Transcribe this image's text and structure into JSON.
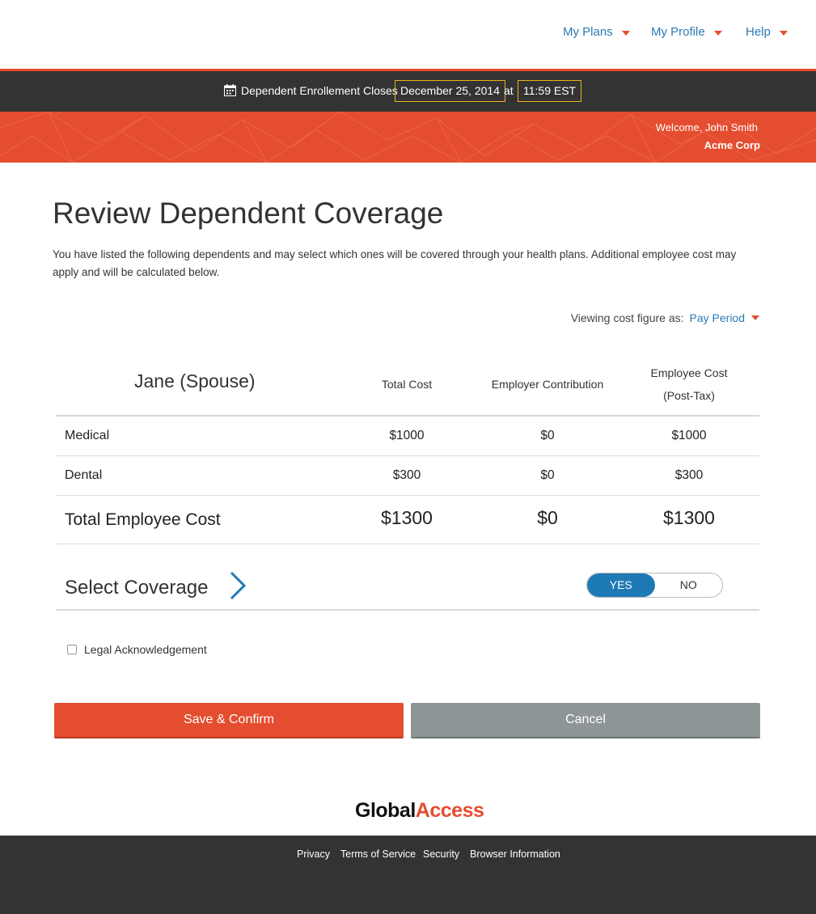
{
  "nav": {
    "items": [
      {
        "label": "My Plans"
      },
      {
        "label": "My Profile"
      },
      {
        "label": "Help"
      }
    ]
  },
  "deadline": {
    "label": "Dependent Enrollement Closes",
    "date": "December 25, 2014",
    "at": "at",
    "time": "11:59 EST"
  },
  "banner": {
    "welcome": "Welcome, John Smith",
    "company": "Acme Corp"
  },
  "page": {
    "title": "Review Dependent Coverage",
    "intro": "You have listed the following dependents and may select which ones will be covered through your health plans. Additional employee cost may apply and will be calculated below."
  },
  "viewing": {
    "label": "Viewing cost figure as:",
    "value": "Pay Period"
  },
  "table": {
    "dependent": "Jane (Spouse)",
    "headers": {
      "total": "Total Cost",
      "employer": "Employer Contribution",
      "employee_line1": "Employee Cost",
      "employee_line2": "(Post-Tax)"
    },
    "rows": [
      {
        "label": "Medical",
        "total": "$1000",
        "employer": "$0",
        "employee": "$1000"
      },
      {
        "label": "Dental",
        "total": "$300",
        "employer": "$0",
        "employee": "$300"
      }
    ],
    "totals": {
      "label": "Total Employee Cost",
      "total": "$1300",
      "employer": "$0",
      "employee": "$1300"
    }
  },
  "coverage": {
    "label": "Select Coverage",
    "yes": "YES",
    "no": "NO",
    "selected": "YES"
  },
  "legal": {
    "label": "Legal Acknowledgement",
    "checked": false
  },
  "buttons": {
    "save": "Save & Confirm",
    "cancel": "Cancel"
  },
  "logo": {
    "part1": "Global",
    "part2": "Access"
  },
  "footer": {
    "links": [
      "Privacy",
      "Terms of Service",
      "Security",
      "Browser Information"
    ]
  },
  "colors": {
    "accent": "#e44d2f",
    "link": "#2a7ab4",
    "dark": "#333333",
    "toggle": "#1e7ab6"
  }
}
